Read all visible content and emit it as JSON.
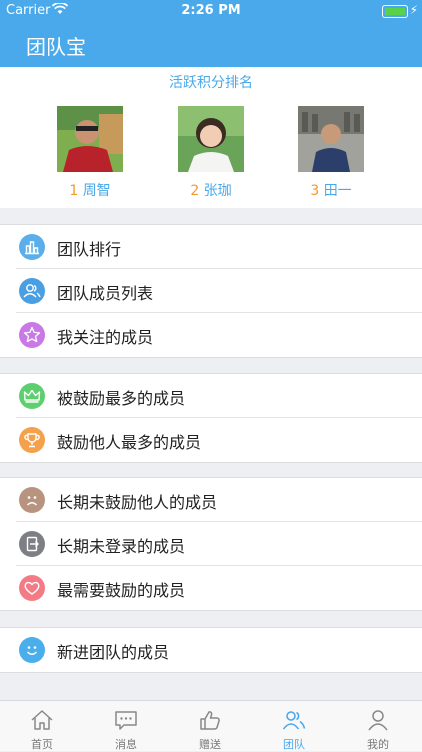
{
  "status_bar": {
    "carrier": "Carrier",
    "time": "2:26 PM"
  },
  "nav": {
    "title": "团队宝"
  },
  "ranking": {
    "heading": "活跃积分排名",
    "members": [
      {
        "rank": "1",
        "name": "周智"
      },
      {
        "rank": "2",
        "name": "张珈"
      },
      {
        "rank": "3",
        "name": "田一"
      }
    ]
  },
  "groups": [
    [
      {
        "label": "团队排行",
        "icon": "bar-chart-icon",
        "color": "#5aaeea"
      },
      {
        "label": "团队成员列表",
        "icon": "members-icon",
        "color": "#4a9fe3"
      },
      {
        "label": "我关注的成员",
        "icon": "star-icon",
        "color": "#c879e6"
      }
    ],
    [
      {
        "label": "被鼓励最多的成员",
        "icon": "crown-icon",
        "color": "#5dcf6e"
      },
      {
        "label": "鼓励他人最多的成员",
        "icon": "trophy-icon",
        "color": "#f5a04a"
      }
    ],
    [
      {
        "label": "长期未鼓励他人的成员",
        "icon": "sad-face-icon",
        "color": "#b89480"
      },
      {
        "label": "长期未登录的成员",
        "icon": "logout-icon",
        "color": "#7d7e86"
      },
      {
        "label": "最需要鼓励的成员",
        "icon": "heart-icon",
        "color": "#f27b86"
      }
    ],
    [
      {
        "label": "新进团队的成员",
        "icon": "smile-face-icon",
        "color": "#4aaeea"
      }
    ]
  ],
  "tabs": [
    {
      "label": "首页",
      "icon": "home-icon",
      "active": false
    },
    {
      "label": "消息",
      "icon": "message-icon",
      "active": false
    },
    {
      "label": "赠送",
      "icon": "thumbs-up-icon",
      "active": false
    },
    {
      "label": "团队",
      "icon": "team-icon",
      "active": true
    },
    {
      "label": "我的",
      "icon": "profile-icon",
      "active": false
    }
  ],
  "colors": {
    "brand": "#4aa9ea",
    "rank": "#f29a2e"
  }
}
